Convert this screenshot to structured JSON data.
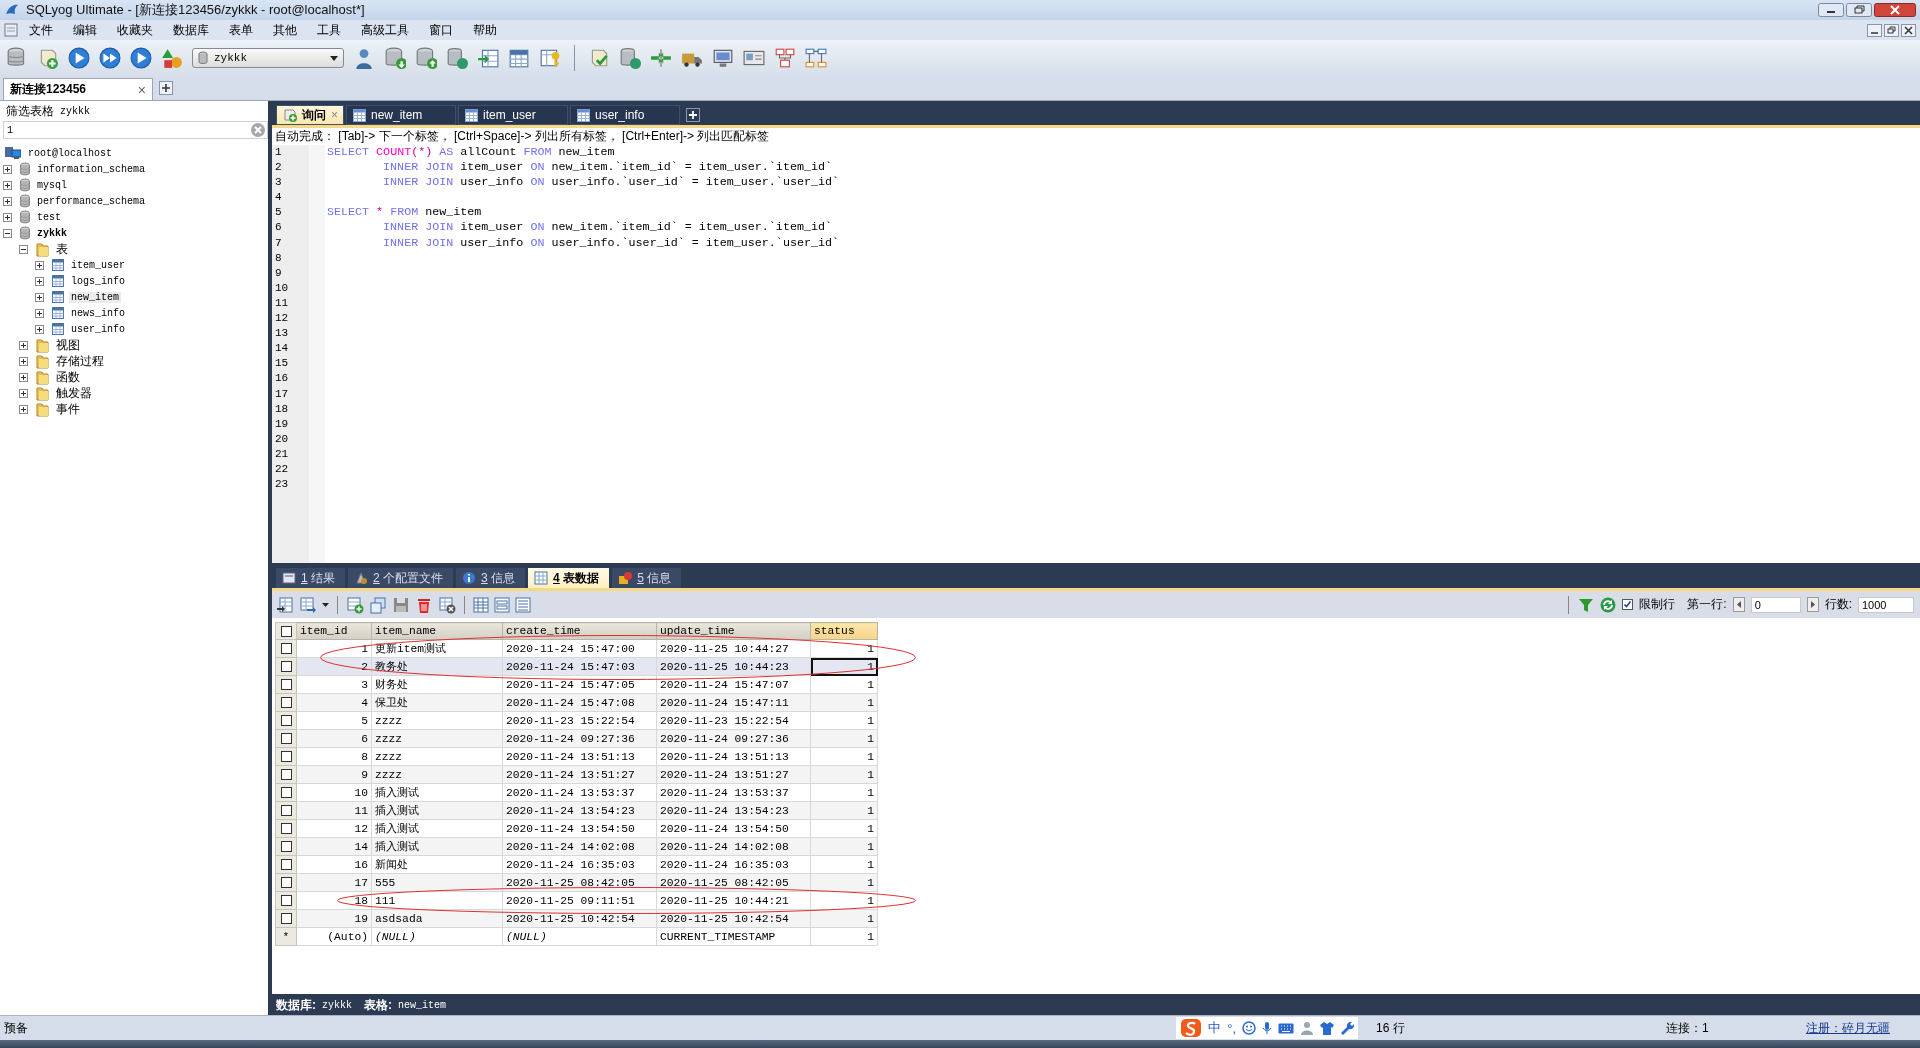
{
  "window": {
    "title": "SQLyog Ultimate - [新连接123456/zykkk - root@localhost*]"
  },
  "menu": [
    "文件",
    "编辑",
    "收藏夹",
    "数据库",
    "表单",
    "其他",
    "工具",
    "高级工具",
    "窗口",
    "帮助"
  ],
  "toolbar": {
    "database": "zykkk"
  },
  "connection_tabs": [
    {
      "label": "新连接123456",
      "selected": true,
      "close": "×"
    }
  ],
  "sidebar": {
    "filter_label": "筛选表格",
    "filter_db": "zykkk",
    "filter_value": "1",
    "tree": [
      {
        "label": "root@localhost",
        "kind": "server",
        "selected": false,
        "children": [
          {
            "label": "information_schema",
            "kind": "database",
            "expanded": false,
            "selected": false
          },
          {
            "label": "mysql",
            "kind": "database",
            "expanded": false,
            "selected": false
          },
          {
            "label": "performance_schema",
            "kind": "database",
            "expanded": false,
            "selected": false
          },
          {
            "label": "test",
            "kind": "database",
            "expanded": false,
            "selected": false
          },
          {
            "label": "zykkk",
            "kind": "database",
            "expanded": true,
            "selected": false,
            "active": true,
            "children": [
              {
                "label": "表",
                "kind": "folder",
                "expanded": true,
                "selected": false,
                "children": [
                  {
                    "label": "item_user",
                    "kind": "table",
                    "expanded": false,
                    "selected": false
                  },
                  {
                    "label": "logs_info",
                    "kind": "table",
                    "expanded": false,
                    "selected": false
                  },
                  {
                    "label": "new_item",
                    "kind": "table",
                    "expanded": false,
                    "selected": true
                  },
                  {
                    "label": "news_info",
                    "kind": "table",
                    "expanded": false,
                    "selected": false
                  },
                  {
                    "label": "user_info",
                    "kind": "table",
                    "expanded": false,
                    "selected": false
                  }
                ]
              },
              {
                "label": "视图",
                "kind": "folder",
                "expanded": false,
                "selected": false
              },
              {
                "label": "存储过程",
                "kind": "folder",
                "expanded": false,
                "selected": false
              },
              {
                "label": "函数",
                "kind": "folder",
                "expanded": false,
                "selected": false
              },
              {
                "label": "触发器",
                "kind": "folder",
                "expanded": false,
                "selected": false
              },
              {
                "label": "事件",
                "kind": "folder",
                "expanded": false,
                "selected": false
              }
            ]
          }
        ]
      }
    ]
  },
  "query_tabs": [
    {
      "label": "询问",
      "kind": "query",
      "selected": true,
      "close": "×"
    },
    {
      "label": "new_item",
      "kind": "table",
      "selected": false
    },
    {
      "label": "item_user",
      "kind": "table",
      "selected": false
    },
    {
      "label": "user_info",
      "kind": "table",
      "selected": false
    }
  ],
  "editor": {
    "hint": "自动完成： [Tab]-> 下一个标签， [Ctrl+Space]-> 列出所有标签， [Ctrl+Enter]-> 列出匹配标签",
    "lines": [
      {
        "number": "1",
        "indented": false,
        "tokens": [
          {
            "text": "SELECT ",
            "kind": "keyword"
          },
          {
            "text": "COUNT",
            "kind": "function"
          },
          {
            "text": "(*) ",
            "kind": "operator"
          },
          {
            "text": "AS ",
            "kind": "keyword"
          },
          {
            "text": "allCount ",
            "kind": "plain"
          },
          {
            "text": "FROM ",
            "kind": "keyword"
          },
          {
            "text": "new_item",
            "kind": "plain"
          }
        ]
      },
      {
        "number": "2",
        "indented": true,
        "tokens": [
          {
            "text": "INNER JOIN ",
            "kind": "keyword"
          },
          {
            "text": "item_user ",
            "kind": "plain"
          },
          {
            "text": "ON ",
            "kind": "keyword"
          },
          {
            "text": "new_item.`item_id` = item_user.`item_id`",
            "kind": "plain"
          }
        ]
      },
      {
        "number": "3",
        "indented": true,
        "tokens": [
          {
            "text": "INNER JOIN ",
            "kind": "keyword"
          },
          {
            "text": "user_info ",
            "kind": "plain"
          },
          {
            "text": "ON ",
            "kind": "keyword"
          },
          {
            "text": "user_info.`user_id` = item_user.`user_id`",
            "kind": "plain"
          }
        ]
      },
      {
        "number": "4"
      },
      {
        "number": "5",
        "indented": false,
        "tokens": [
          {
            "text": "SELECT ",
            "kind": "keyword"
          },
          {
            "text": "* ",
            "kind": "operator"
          },
          {
            "text": "FROM ",
            "kind": "keyword"
          },
          {
            "text": "new_item",
            "kind": "plain"
          }
        ]
      },
      {
        "number": "6",
        "indented": true,
        "tokens": [
          {
            "text": "INNER JOIN ",
            "kind": "keyword"
          },
          {
            "text": "item_user ",
            "kind": "plain"
          },
          {
            "text": "ON ",
            "kind": "keyword"
          },
          {
            "text": "new_item.`item_id` = item_user.`item_id`",
            "kind": "plain"
          }
        ]
      },
      {
        "number": "7",
        "indented": true,
        "tokens": [
          {
            "text": "INNER JOIN ",
            "kind": "keyword"
          },
          {
            "text": "user_info ",
            "kind": "plain"
          },
          {
            "text": "ON ",
            "kind": "keyword"
          },
          {
            "text": "user_info.`user_id` = item_user.`user_id`",
            "kind": "plain"
          }
        ]
      },
      {
        "number": "8"
      },
      {
        "number": "9"
      },
      {
        "number": "10"
      },
      {
        "number": "11"
      },
      {
        "number": "12"
      },
      {
        "number": "13"
      },
      {
        "number": "14"
      },
      {
        "number": "15"
      },
      {
        "number": "16"
      },
      {
        "number": "17"
      },
      {
        "number": "18"
      },
      {
        "number": "19"
      },
      {
        "number": "20"
      },
      {
        "number": "21"
      },
      {
        "number": "22"
      },
      {
        "number": "23"
      }
    ]
  },
  "result_tabs": [
    {
      "number": "1",
      "label": "结果",
      "kind": "result",
      "selected": false
    },
    {
      "number": "2",
      "label": "个配置文件",
      "kind": "profile",
      "selected": false
    },
    {
      "number": "3",
      "label": "信息",
      "kind": "info",
      "selected": false
    },
    {
      "number": "4",
      "label": "表数据",
      "kind": "table",
      "selected": true
    },
    {
      "number": "5",
      "label": "信息",
      "kind": "history",
      "selected": false
    }
  ],
  "result_toolbar": {
    "limit_checked": true,
    "limit_label": "限制行",
    "first_row_label": "第一行:",
    "first_row": "0",
    "rows_label": "行数:",
    "rows": "1000"
  },
  "table": {
    "header_checked": false,
    "columns": [
      "item_id",
      "item_name",
      "create_time",
      "update_time",
      "status"
    ],
    "rows": [
      {
        "kind": "data",
        "checked": false,
        "selected": false,
        "circled": true,
        "cells": [
          "1",
          "更新item测试",
          "2020-11-24 15:47:00",
          "2020-11-25 10:44:27",
          "1"
        ]
      },
      {
        "kind": "data",
        "checked": false,
        "selected": true,
        "circled": true,
        "cells": [
          "2",
          "教务处",
          "2020-11-24 15:47:03",
          "2020-11-25 10:44:23",
          "1"
        ]
      },
      {
        "kind": "data",
        "checked": false,
        "selected": false,
        "circled": false,
        "cells": [
          "3",
          "财务处",
          "2020-11-24 15:47:05",
          "2020-11-24 15:47:07",
          "1"
        ]
      },
      {
        "kind": "data",
        "checked": false,
        "selected": false,
        "circled": false,
        "cells": [
          "4",
          "保卫处",
          "2020-11-24 15:47:08",
          "2020-11-24 15:47:11",
          "1"
        ]
      },
      {
        "kind": "data",
        "checked": false,
        "selected": false,
        "circled": false,
        "cells": [
          "5",
          "zzzz",
          "2020-11-23 15:22:54",
          "2020-11-23 15:22:54",
          "1"
        ]
      },
      {
        "kind": "data",
        "checked": false,
        "selected": false,
        "circled": false,
        "cells": [
          "6",
          "zzzz",
          "2020-11-24 09:27:36",
          "2020-11-24 09:27:36",
          "1"
        ]
      },
      {
        "kind": "data",
        "checked": false,
        "selected": false,
        "circled": false,
        "cells": [
          "8",
          "zzzz",
          "2020-11-24 13:51:13",
          "2020-11-24 13:51:13",
          "1"
        ]
      },
      {
        "kind": "data",
        "checked": false,
        "selected": false,
        "circled": false,
        "cells": [
          "9",
          "zzzz",
          "2020-11-24 13:51:27",
          "2020-11-24 13:51:27",
          "1"
        ]
      },
      {
        "kind": "data",
        "checked": false,
        "selected": false,
        "circled": false,
        "cells": [
          "10",
          "插入测试",
          "2020-11-24 13:53:37",
          "2020-11-24 13:53:37",
          "1"
        ]
      },
      {
        "kind": "data",
        "checked": false,
        "selected": false,
        "circled": false,
        "cells": [
          "11",
          "插入测试",
          "2020-11-24 13:54:23",
          "2020-11-24 13:54:23",
          "1"
        ]
      },
      {
        "kind": "data",
        "checked": false,
        "selected": false,
        "circled": false,
        "cells": [
          "12",
          "插入测试",
          "2020-11-24 13:54:50",
          "2020-11-24 13:54:50",
          "1"
        ]
      },
      {
        "kind": "data",
        "checked": false,
        "selected": false,
        "circled": false,
        "cells": [
          "14",
          "插入测试",
          "2020-11-24 14:02:08",
          "2020-11-24 14:02:08",
          "1"
        ]
      },
      {
        "kind": "data",
        "checked": false,
        "selected": false,
        "circled": false,
        "cells": [
          "16",
          "新闻处",
          "2020-11-24 16:35:03",
          "2020-11-24 16:35:03",
          "1"
        ]
      },
      {
        "kind": "data",
        "checked": false,
        "selected": false,
        "circled": false,
        "cells": [
          "17",
          "555",
          "2020-11-25 08:42:05",
          "2020-11-25 08:42:05",
          "1"
        ]
      },
      {
        "kind": "data",
        "checked": false,
        "selected": false,
        "circled": true,
        "cells": [
          "18",
          "111",
          "2020-11-25 09:11:51",
          "2020-11-25 10:44:21",
          "1"
        ]
      },
      {
        "kind": "data",
        "checked": false,
        "selected": false,
        "circled": false,
        "cells": [
          "19",
          "asdsada",
          "2020-11-25 10:42:54",
          "2020-11-25 10:42:54",
          "1"
        ]
      },
      {
        "kind": "new",
        "marker": "*",
        "selected": false,
        "circled": false,
        "cells": [
          "(Auto)",
          {
            "text": "(NULL)",
            "italic": true
          },
          {
            "text": "(NULL)",
            "italic": true
          },
          "CURRENT_TIMESTAMP",
          "1"
        ]
      }
    ]
  },
  "info_strip": {
    "db_label": "数据库:",
    "db": "zykkk",
    "table_label": "表格:",
    "table": "new_item"
  },
  "status_bar": {
    "state": "预备",
    "ime_mode": "中",
    "ime_punct": "°,",
    "rows": "16 行",
    "connections": "连接：1",
    "registered": "注册：碎月无疆"
  }
}
